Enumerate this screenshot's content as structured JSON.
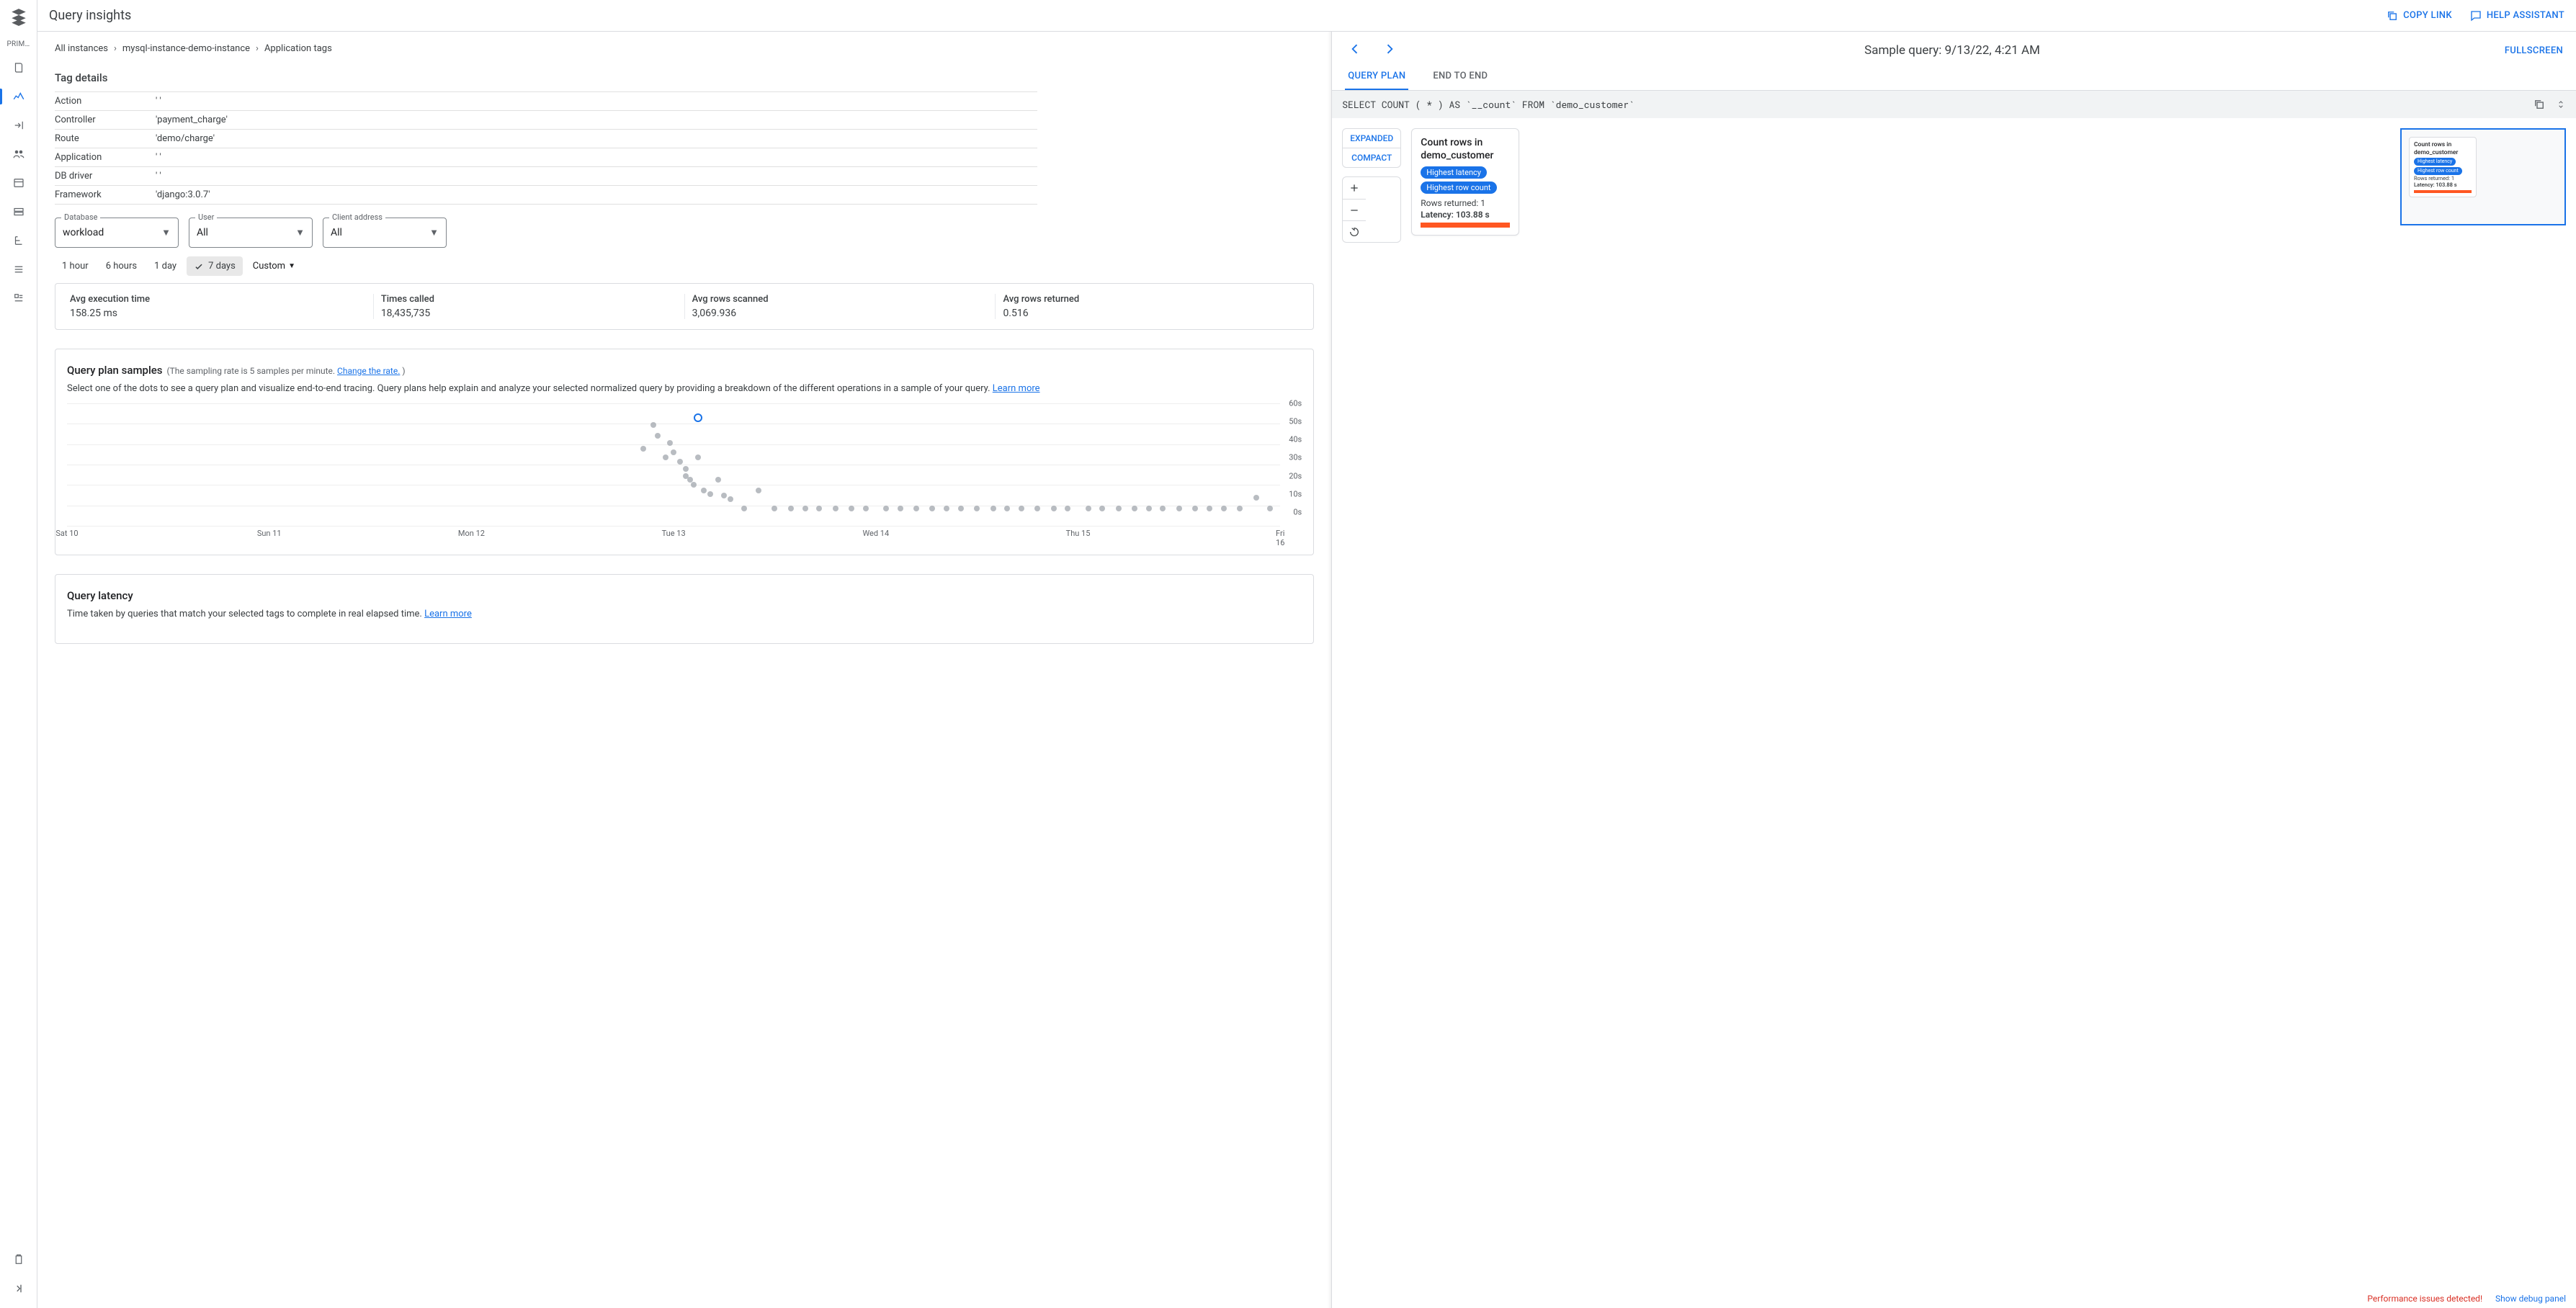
{
  "sideRail": {
    "sectionLabel": "PRIM…"
  },
  "titlebar": {
    "title": "Query insights",
    "copyLink": "COPY LINK",
    "helpAssistant": "HELP ASSISTANT"
  },
  "breadcrumbs": {
    "root": "All instances",
    "instance": "mysql-instance-demo-instance",
    "leaf": "Application tags"
  },
  "tagDetails": {
    "heading": "Tag details",
    "rows": [
      {
        "k": "Action",
        "v": "' '"
      },
      {
        "k": "Controller",
        "v": "'payment_charge'"
      },
      {
        "k": "Route",
        "v": "'demo/charge'"
      },
      {
        "k": "Application",
        "v": "' '"
      },
      {
        "k": "DB driver",
        "v": "' '"
      },
      {
        "k": "Framework",
        "v": "'django:3.0.7'"
      }
    ]
  },
  "filters": {
    "database": {
      "label": "Database",
      "value": "workload"
    },
    "user": {
      "label": "User",
      "value": "All"
    },
    "client": {
      "label": "Client address",
      "value": "All"
    }
  },
  "timerange": {
    "h1": "1 hour",
    "h6": "6 hours",
    "d1": "1 day",
    "d7": "7 days",
    "custom": "Custom"
  },
  "stats": {
    "execLabel": "Avg execution time",
    "execVal": "158.25 ms",
    "callsLabel": "Times called",
    "callsVal": "18,435,735",
    "scannedLabel": "Avg rows scanned",
    "scannedVal": "3,069.936",
    "returnedLabel": "Avg rows returned",
    "returnedVal": "0.516"
  },
  "samples": {
    "title": "Query plan samples",
    "rateNote": "(The sampling rate is 5 samples per minute. ",
    "changeRate": "Change the rate.",
    "rateNoteEnd": " )",
    "desc1": "Select one of the dots to see a query plan and visualize end-to-end tracing. Query plans help explain and analyze your selected normalized query by providing a breakdown of the different operations in a sample of your query. ",
    "learnMore": "Learn more"
  },
  "latency": {
    "title": "Query latency",
    "desc": "Time taken by queries that match your selected tags to complete in real elapsed time. ",
    "learnMore": "Learn more"
  },
  "rightPanel": {
    "sampleTitle": "Sample query: 9/13/22, 4:21 AM",
    "fullscreen": "FULLSCREEN",
    "tabPlan": "QUERY PLAN",
    "tabE2E": "END TO END",
    "sql": "SELECT COUNT ( * ) AS `__count` FROM `demo_customer`",
    "expanded": "EXPANDED",
    "compact": "COMPACT",
    "node": {
      "title": "Count rows in demo_customer",
      "badge1": "Highest latency",
      "badge2": "Highest row count",
      "rows": "Rows returned: 1",
      "latency": "Latency: 103.88 s"
    },
    "minimap": {
      "title": "Count rows in demo_customer",
      "badge1": "Highest latency",
      "badge2": "Highest row count",
      "rows": "Rows returned: 1",
      "latency": "Latency: 103.88 s"
    }
  },
  "footer": {
    "alert": "Performance issues detected!",
    "debug": "Show debug panel"
  },
  "chart_data": {
    "type": "scatter",
    "xlabel": "",
    "ylabel": "seconds",
    "ylim": [
      0,
      60
    ],
    "xticks": [
      "Sat 10",
      "Sun 11",
      "Mon 12",
      "Tue 13",
      "Wed 14",
      "Thu 15",
      "Fri 16"
    ],
    "yticks": [
      0,
      10,
      20,
      30,
      40,
      50,
      60
    ],
    "points": [
      {
        "x": 2.85,
        "y": 35
      },
      {
        "x": 2.9,
        "y": 48
      },
      {
        "x": 2.92,
        "y": 42
      },
      {
        "x": 2.96,
        "y": 30
      },
      {
        "x": 2.98,
        "y": 38
      },
      {
        "x": 3.0,
        "y": 33
      },
      {
        "x": 3.03,
        "y": 28
      },
      {
        "x": 3.06,
        "y": 20
      },
      {
        "x": 3.06,
        "y": 24
      },
      {
        "x": 3.08,
        "y": 18
      },
      {
        "x": 3.1,
        "y": 15
      },
      {
        "x": 3.12,
        "y": 30
      },
      {
        "x": 3.15,
        "y": 12
      },
      {
        "x": 3.18,
        "y": 10
      },
      {
        "x": 3.22,
        "y": 18
      },
      {
        "x": 3.25,
        "y": 9
      },
      {
        "x": 3.28,
        "y": 7
      },
      {
        "x": 3.35,
        "y": 2
      },
      {
        "x": 3.42,
        "y": 12
      },
      {
        "x": 3.5,
        "y": 2
      },
      {
        "x": 3.58,
        "y": 2
      },
      {
        "x": 3.65,
        "y": 2
      },
      {
        "x": 3.72,
        "y": 2
      },
      {
        "x": 3.8,
        "y": 2
      },
      {
        "x": 3.88,
        "y": 2
      },
      {
        "x": 3.95,
        "y": 2
      },
      {
        "x": 4.05,
        "y": 2
      },
      {
        "x": 4.12,
        "y": 2
      },
      {
        "x": 4.2,
        "y": 2
      },
      {
        "x": 4.28,
        "y": 2
      },
      {
        "x": 4.35,
        "y": 2
      },
      {
        "x": 4.42,
        "y": 2
      },
      {
        "x": 4.5,
        "y": 2
      },
      {
        "x": 4.58,
        "y": 2
      },
      {
        "x": 4.65,
        "y": 2
      },
      {
        "x": 4.72,
        "y": 2
      },
      {
        "x": 4.8,
        "y": 2
      },
      {
        "x": 4.88,
        "y": 2
      },
      {
        "x": 4.95,
        "y": 2
      },
      {
        "x": 5.05,
        "y": 2
      },
      {
        "x": 5.12,
        "y": 2
      },
      {
        "x": 5.2,
        "y": 2
      },
      {
        "x": 5.28,
        "y": 2
      },
      {
        "x": 5.35,
        "y": 2
      },
      {
        "x": 5.42,
        "y": 2
      },
      {
        "x": 5.5,
        "y": 2
      },
      {
        "x": 5.58,
        "y": 2
      },
      {
        "x": 5.65,
        "y": 2
      },
      {
        "x": 5.72,
        "y": 2
      },
      {
        "x": 5.8,
        "y": 2
      },
      {
        "x": 5.88,
        "y": 8
      },
      {
        "x": 5.95,
        "y": 2
      }
    ],
    "selected_point": {
      "x": 3.12,
      "y": 52
    }
  }
}
